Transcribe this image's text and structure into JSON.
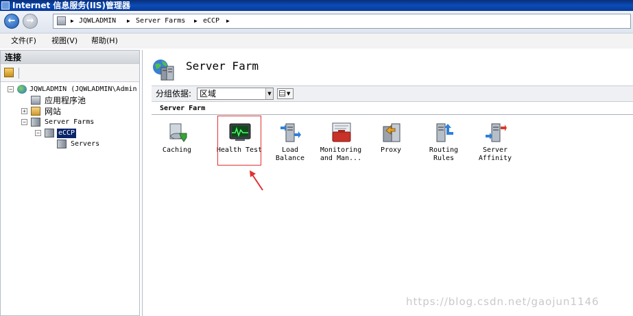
{
  "window": {
    "title": "Internet 信息服务(IIS)管理器"
  },
  "address": {
    "crumbs": [
      "JQWLADMIN",
      "Server Farms",
      "eCCP"
    ]
  },
  "menu": {
    "items": [
      "文件(F)",
      "视图(V)",
      "帮助(H)"
    ]
  },
  "connections": {
    "header": "连接",
    "tree": {
      "server": "JQWLADMIN (JQWLADMIN\\Admin",
      "app_pools": "应用程序池",
      "sites": "网站",
      "server_farms": "Server Farms",
      "farm": "eCCP",
      "servers": "Servers"
    }
  },
  "main": {
    "title": "Server Farm",
    "group_by_label": "分组依据:",
    "group_by_value": "区域",
    "section": "Server Farm",
    "features": [
      {
        "label_line1": "Caching",
        "label_line2": "",
        "icon": "caching-icon"
      },
      {
        "label_line1": "Health Test",
        "label_line2": "",
        "icon": "health-test-icon"
      },
      {
        "label_line1": "Load",
        "label_line2": "Balance",
        "icon": "load-balance-icon"
      },
      {
        "label_line1": "Monitoring",
        "label_line2": "and Man...",
        "icon": "monitoring-icon"
      },
      {
        "label_line1": "Proxy",
        "label_line2": "",
        "icon": "proxy-icon"
      },
      {
        "label_line1": "Routing",
        "label_line2": "Rules",
        "icon": "routing-rules-icon"
      },
      {
        "label_line1": "Server",
        "label_line2": "Affinity",
        "icon": "server-affinity-icon"
      }
    ]
  },
  "watermark": "https://blog.csdn.net/gaojun1146",
  "colors": {
    "highlight": "#e03030",
    "selection": "#0a246a",
    "title_bar": "#0b4cb8"
  }
}
